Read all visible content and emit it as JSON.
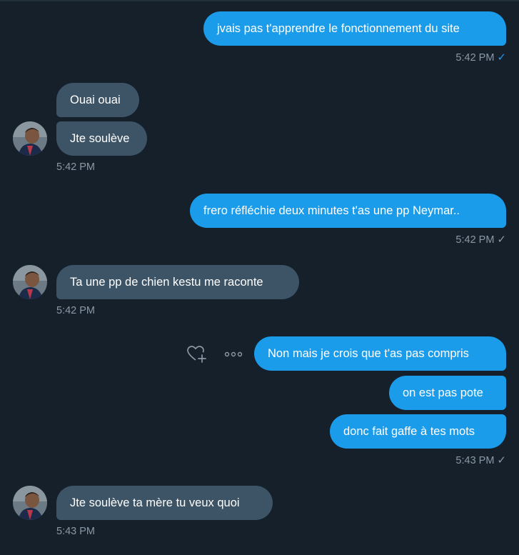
{
  "messages": {
    "m1": {
      "text": "jvais pas t'apprendre le fonctionnement du site",
      "time": "5:42 PM"
    },
    "m2": {
      "text": "Ouai ouai"
    },
    "m3": {
      "text": "Jte soulève",
      "time": "5:42 PM"
    },
    "m4": {
      "text": "frero réfléchie deux minutes t'as une pp Neymar..",
      "time": "5:42 PM"
    },
    "m5": {
      "text": "Ta une pp de chien kestu me raconte",
      "time": "5:42 PM"
    },
    "m6": {
      "text": "Non mais je crois que t'as pas compris"
    },
    "m7": {
      "text": "on est pas pote"
    },
    "m8": {
      "text": "donc fait gaffe à tes mots",
      "time": "5:43 PM"
    },
    "m9": {
      "text": "Jte soulève ta mère tu veux quoi",
      "time": "5:43 PM"
    }
  },
  "icons": {
    "read_check": "check-icon",
    "react": "heart-plus-icon",
    "more": "more-icon"
  },
  "colors": {
    "background": "#15202b",
    "sent_bubble": "#1a9cea",
    "received_bubble": "#3d5466",
    "timestamp": "#8b98a5",
    "read_check": "#1d9bf0"
  }
}
